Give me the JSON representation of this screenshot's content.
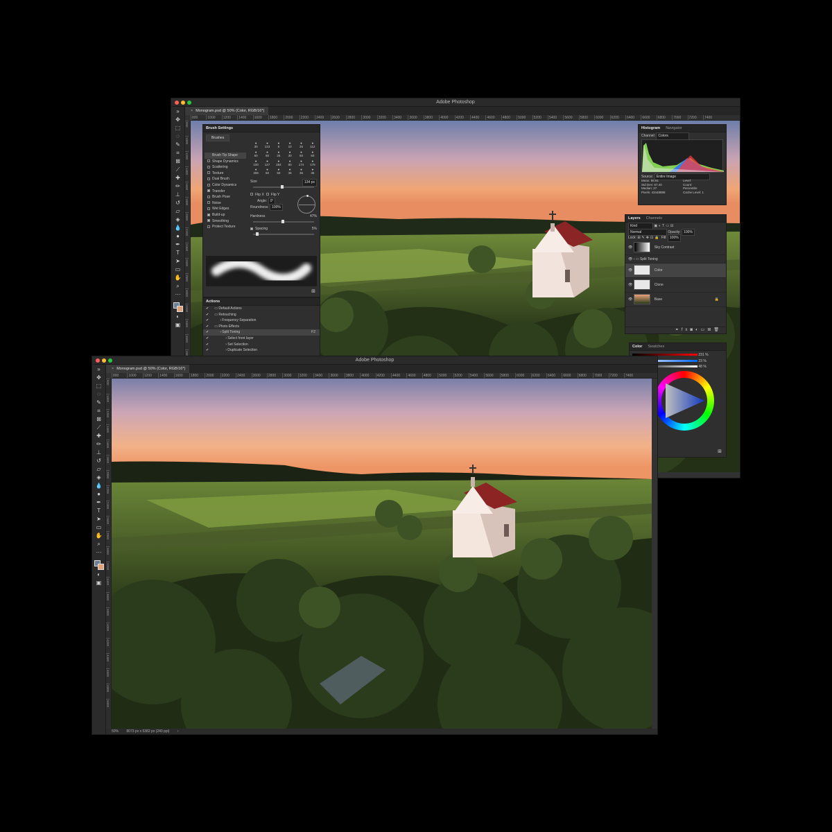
{
  "app_title": "Adobe Photoshop",
  "document_tab": "Monogram.psd @ 50% (Color, RGB/16*)",
  "ruler_h": [
    "800",
    "1000",
    "1200",
    "1400",
    "1600",
    "1800",
    "2000",
    "2200",
    "2400",
    "2600",
    "2800",
    "3000",
    "3200",
    "3400",
    "3600",
    "3800",
    "4000",
    "4200",
    "4400",
    "4600",
    "4800",
    "5000",
    "5200",
    "5400",
    "5600",
    "5800",
    "6000",
    "6200",
    "6400",
    "6600",
    "6800",
    "7000",
    "7200",
    "7400"
  ],
  "ruler_v": [
    "800",
    "1000",
    "1200",
    "1400",
    "1600",
    "1800",
    "2000",
    "2200",
    "2400",
    "2600",
    "2800",
    "3000",
    "3200",
    "3400",
    "3600",
    "3800",
    "4000",
    "4200",
    "4400",
    "4600",
    "4800",
    "5000"
  ],
  "status": {
    "zoom": "50%",
    "doc_info": "8073 px x 5382 px (240 ppi)"
  },
  "brush_settings": {
    "title": "Brush Settings",
    "brushes_button": "Brushes",
    "options": [
      {
        "label": "Brush Tip Shape",
        "checked": null,
        "selected": true
      },
      {
        "label": "Shape Dynamics",
        "checked": false
      },
      {
        "label": "Scattering",
        "checked": false
      },
      {
        "label": "Texture",
        "checked": false
      },
      {
        "label": "Dual Brush",
        "checked": false
      },
      {
        "label": "Color Dynamics",
        "checked": false
      },
      {
        "label": "Transfer",
        "checked": true
      },
      {
        "label": "Brush Pose",
        "checked": false
      },
      {
        "label": "Noise",
        "checked": false
      },
      {
        "label": "Wet Edges",
        "checked": false
      },
      {
        "label": "Build-up",
        "checked": true
      },
      {
        "label": "Smoothing",
        "checked": true
      },
      {
        "label": "Protect Texture",
        "checked": false
      }
    ],
    "tip_sizes": [
      "30",
      "123",
      "8",
      "10",
      "25",
      "112",
      "60",
      "50",
      "25",
      "30",
      "50",
      "60",
      "100",
      "127",
      "284",
      "80",
      "174",
      "175",
      "306",
      "50",
      "50",
      "36",
      "36",
      "36"
    ],
    "size_label": "Size",
    "size_value": "134 px",
    "size_level": 0.45,
    "flip_x": "Flip X",
    "flip_y": "Flip Y",
    "angle_label": "Angle:",
    "angle_value": "0°",
    "roundness_label": "Roundness:",
    "roundness_value": "100%",
    "hardness_label": "Hardness",
    "hardness_value": "47%",
    "hardness_level": 0.47,
    "spacing_label": "Spacing",
    "spacing_value": "5%",
    "spacing_level": 0.05
  },
  "actions": {
    "title": "Actions",
    "items": [
      {
        "label": "Default Actions",
        "indent": 0,
        "kind": "set"
      },
      {
        "label": "Retouching",
        "indent": 0,
        "kind": "set"
      },
      {
        "label": "Frequency Separation",
        "indent": 1,
        "kind": "action"
      },
      {
        "label": "Photo Effects",
        "indent": 0,
        "kind": "set"
      },
      {
        "label": "Split Toning",
        "indent": 1,
        "kind": "action",
        "selected": true,
        "shortcut": "F2"
      },
      {
        "label": "Select front layer",
        "indent": 2,
        "kind": "step"
      },
      {
        "label": "Set Selection",
        "indent": 2,
        "kind": "step"
      },
      {
        "label": "Duplicate Selection",
        "indent": 2,
        "kind": "step"
      }
    ]
  },
  "histogram": {
    "tabs": [
      "Histogram",
      "Navigator"
    ],
    "channel_label": "Channel:",
    "channel_value": "Colors",
    "source_label": "Source:",
    "source_value": "Entire Image",
    "stats_left": [
      [
        "Mean:",
        "86.81"
      ],
      [
        "Std Dev:",
        "67.40"
      ],
      [
        "Median:",
        "27"
      ],
      [
        "Pixels:",
        "43448886"
      ]
    ],
    "stats_right": [
      "Level:",
      "Count:",
      "Percentile:",
      "Cache Level: 1"
    ]
  },
  "layers": {
    "tabs": [
      "Layers",
      "Channels"
    ],
    "filter": "Kind",
    "blend_mode": "Normal",
    "opacity_label": "Opacity:",
    "opacity_value": "100%",
    "lock_label": "Lock:",
    "fill_label": "Fill:",
    "fill_value": "100%",
    "items": [
      {
        "name": "Sky Contrast",
        "type": "adjustment"
      },
      {
        "name": "Split Toning",
        "type": "group"
      },
      {
        "name": "Color",
        "type": "layer",
        "selected": true
      },
      {
        "name": "Clone",
        "type": "layer"
      },
      {
        "name": "Base",
        "type": "layer",
        "locked": true
      }
    ]
  },
  "color_panel": {
    "tabs": [
      "Color",
      "Swatches"
    ],
    "values": [
      "231",
      "23",
      "48"
    ],
    "unit": "%"
  },
  "colors": {
    "accent": "#1473e6",
    "foreground": "#6b7c93",
    "background": "#e3a276"
  }
}
